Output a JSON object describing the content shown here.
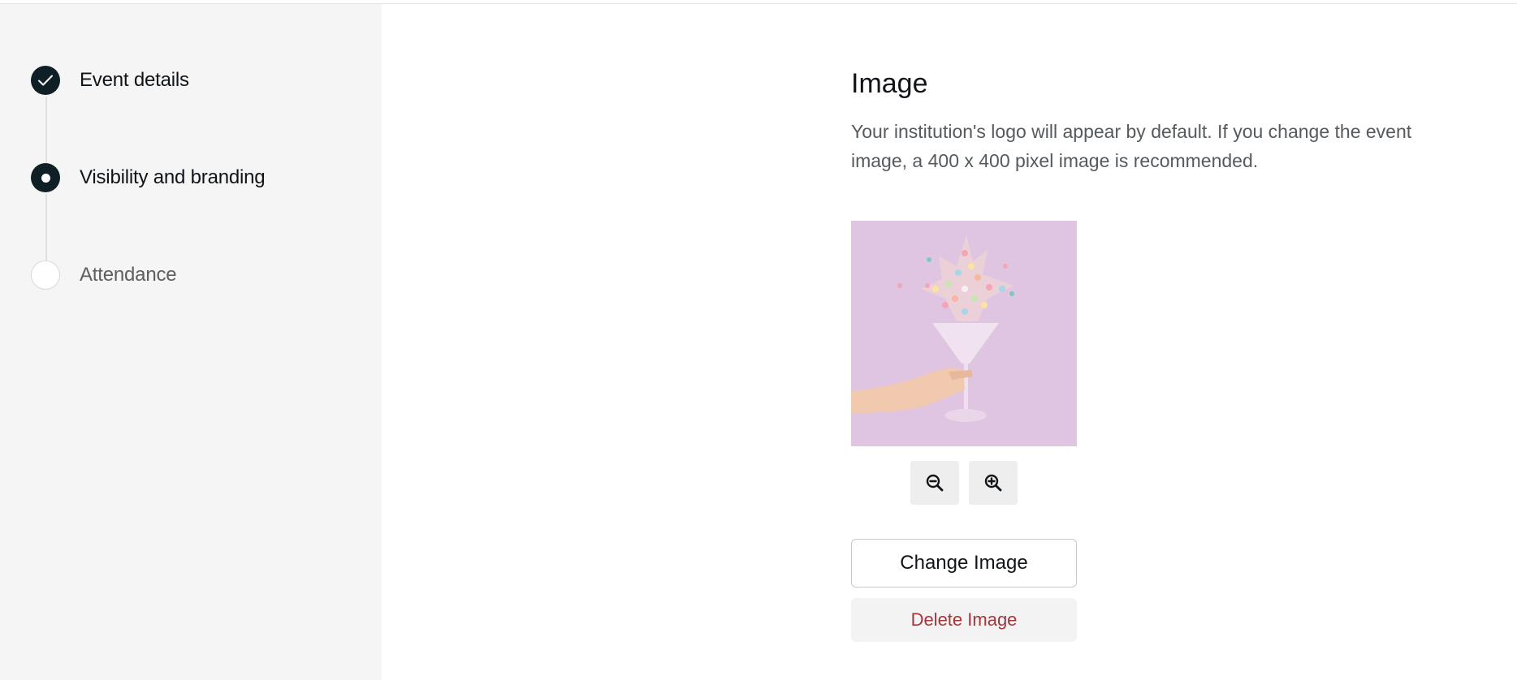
{
  "steps": [
    {
      "label": "Event details",
      "state": "done",
      "icon": "check-icon"
    },
    {
      "label": "Visibility and branding",
      "state": "current",
      "icon": "dot-icon"
    },
    {
      "label": "Attendance",
      "state": "todo",
      "icon": "empty-circle-icon"
    }
  ],
  "image_section": {
    "title": "Image",
    "description": "Your institution's logo will appear by default. If you change the event image, a 400 x 400 pixel image is recommended.",
    "preview_background": "#e0c5e2",
    "zoom_out_icon": "zoom-out-icon",
    "zoom_in_icon": "zoom-in-icon",
    "change_label": "Change Image",
    "delete_label": "Delete Image"
  },
  "colors": {
    "step_active": "#0f1f26",
    "sidebar_bg": "#f5f5f5",
    "delete_text": "#a4353d"
  }
}
